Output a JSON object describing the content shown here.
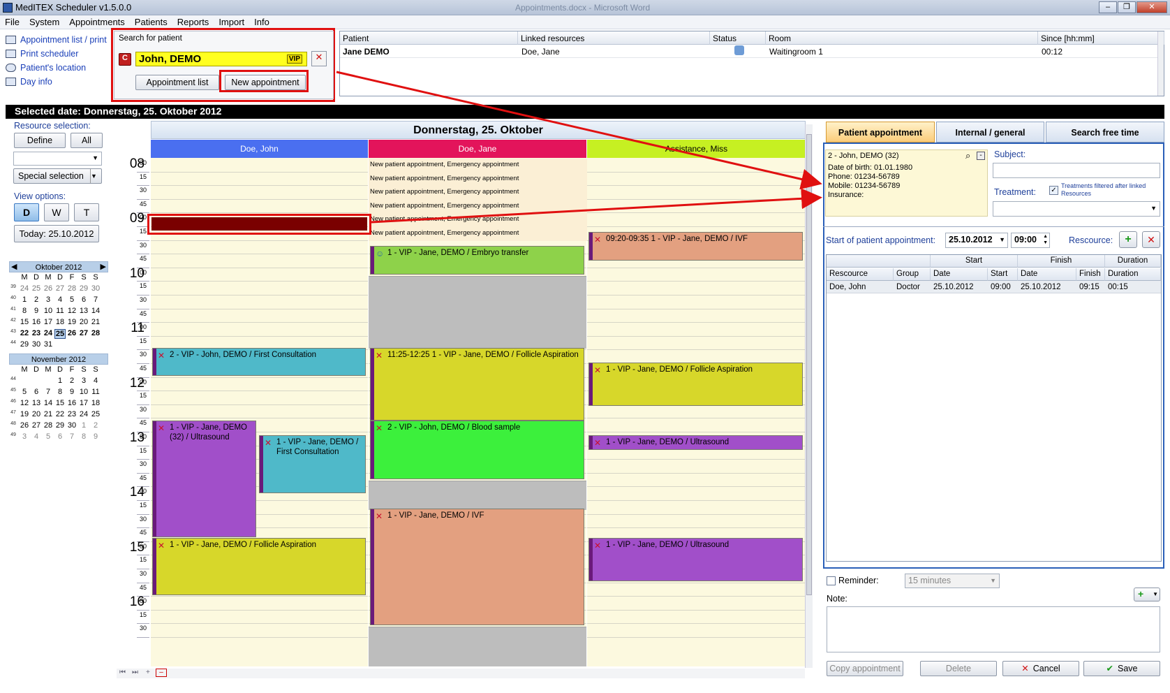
{
  "window": {
    "title": "MedITEX  Scheduler v1.5.0.0",
    "center_title": "Appointments.docx - Microsoft Word",
    "controls": [
      "–",
      "❐",
      "✕"
    ]
  },
  "menu": [
    "File",
    "System",
    "Appointments",
    "Patients",
    "Reports",
    "Import",
    "Info"
  ],
  "left_links": [
    "Appointment list / print",
    "Print scheduler",
    "Patient's location",
    "Day info"
  ],
  "search": {
    "title": "Search for patient",
    "patient": "John, DEMO",
    "vip": "VIP",
    "appointment_list": "Appointment list",
    "new_appointment": "New appointment"
  },
  "waiting": {
    "headers": [
      "Patient",
      "Linked resources",
      "Status",
      "Room",
      "Since [hh:mm]"
    ],
    "row": {
      "patient": "Jane DEMO",
      "linked": "Doe, Jane",
      "room": "Waitingroom 1",
      "since": "00:12"
    }
  },
  "selected_date": "Selected date: Donnerstag, 25. Oktober 2012",
  "left": {
    "resource_selection": "Resource selection:",
    "define": "Define",
    "all": "All",
    "special_selection": "Special selection",
    "view_options": "View options:",
    "view_d": "D",
    "view_w": "W",
    "view_t": "T",
    "today": "Today: 25.10.2012",
    "cal1_title": "Oktober 2012",
    "cal2_title": "November 2012",
    "weekdays": [
      "M",
      "D",
      "M",
      "D",
      "F",
      "S",
      "S"
    ]
  },
  "calendar_oct": {
    "weeks": [
      "39",
      "40",
      "41",
      "42",
      "43",
      "44"
    ],
    "rows": [
      [
        "24",
        "25",
        "26",
        "27",
        "28",
        "29",
        "30"
      ],
      [
        "1",
        "2",
        "3",
        "4",
        "5",
        "6",
        "7"
      ],
      [
        "8",
        "9",
        "10",
        "11",
        "12",
        "13",
        "14"
      ],
      [
        "15",
        "16",
        "17",
        "18",
        "19",
        "20",
        "21"
      ],
      [
        "22",
        "23",
        "24",
        "25",
        "26",
        "27",
        "28"
      ],
      [
        "29",
        "30",
        "31",
        "",
        "",
        "",
        ""
      ]
    ]
  },
  "calendar_nov": {
    "weeks": [
      "44",
      "45",
      "46",
      "47",
      "48",
      "49"
    ],
    "rows": [
      [
        "",
        "",
        "",
        "1",
        "2",
        "3",
        "4"
      ],
      [
        "5",
        "6",
        "7",
        "8",
        "9",
        "10",
        "11"
      ],
      [
        "12",
        "13",
        "14",
        "15",
        "16",
        "17",
        "18"
      ],
      [
        "19",
        "20",
        "21",
        "22",
        "23",
        "24",
        "25"
      ],
      [
        "26",
        "27",
        "28",
        "29",
        "30",
        "1",
        "2"
      ],
      [
        "3",
        "4",
        "5",
        "6",
        "7",
        "8",
        "9"
      ]
    ]
  },
  "schedule": {
    "day_title": "Donnerstag, 25. Oktober",
    "columns": [
      {
        "name": "Doe, John",
        "color": "#4a6ff0"
      },
      {
        "name": "Doe, Jane",
        "color": "#e3145b"
      },
      {
        "name": "Assistance, Miss",
        "color": "#c6f022"
      }
    ],
    "hours": [
      "08",
      "09",
      "10",
      "11",
      "12",
      "13",
      "14",
      "15",
      "16"
    ],
    "minutes": [
      "00",
      "15",
      "30",
      "45"
    ],
    "emergency_label": "New patient appointment, Emergency appointment",
    "appointments": {
      "a1": "1 - VIP - Jane, DEMO / Embryo transfer",
      "a2": "09:20-09:35 1 - VIP - Jane, DEMO / IVF",
      "a3": "2 - VIP - John, DEMO / First Consultation",
      "a4": "11:25-12:25 1 - VIP - Jane, DEMO / Follicle Aspiration",
      "a5": "1 - VIP - Jane, DEMO / Follicle Aspiration",
      "a6": "1 - VIP - Jane, DEMO (32) / Ultrasound",
      "a7": "1 - VIP - Jane, DEMO / First Consultation",
      "a8": "2 - VIP - John, DEMO / Blood sample",
      "a9": "1 - VIP - Jane, DEMO / Ultrasound",
      "a10": "1 - VIP - Jane, DEMO / IVF",
      "a11": "1 - VIP - Jane, DEMO / Follicle Aspiration",
      "a12": "1 - VIP - Jane, DEMO / Ultrasound"
    }
  },
  "right": {
    "tabs": [
      "Patient appointment",
      "Internal / general",
      "Search free time"
    ],
    "patient_line": "2 - John, DEMO (32)",
    "dob": "Date of birth: 01.01.1980",
    "phone": "Phone: 01234-56789",
    "mobile": "Mobile: 01234-56789",
    "insurance": "Insurance:",
    "subject": "Subject:",
    "treatment": "Treatment:",
    "treat_filter": "Treatments filtered after linked Resources",
    "start_label": "Start of patient appointment:",
    "start_date": "25.10.2012",
    "start_time": "09:00",
    "resource_label": "Rescource:",
    "grid_groups": [
      "Start",
      "Finish",
      "Duration"
    ],
    "grid_headers": [
      "Rescource",
      "Group",
      "Date",
      "Start",
      "Date",
      "Finish",
      "Duration"
    ],
    "grid_row": [
      "Doe, John",
      "Doctor",
      "25.10.2012",
      "09:00",
      "25.10.2012",
      "09:15",
      "00:15"
    ],
    "reminder": "Reminder:",
    "reminder_value": "15 minutes",
    "note": "Note:",
    "copy": "Copy appointment",
    "delete": "Delete",
    "cancel": "Cancel",
    "save": "Save"
  }
}
